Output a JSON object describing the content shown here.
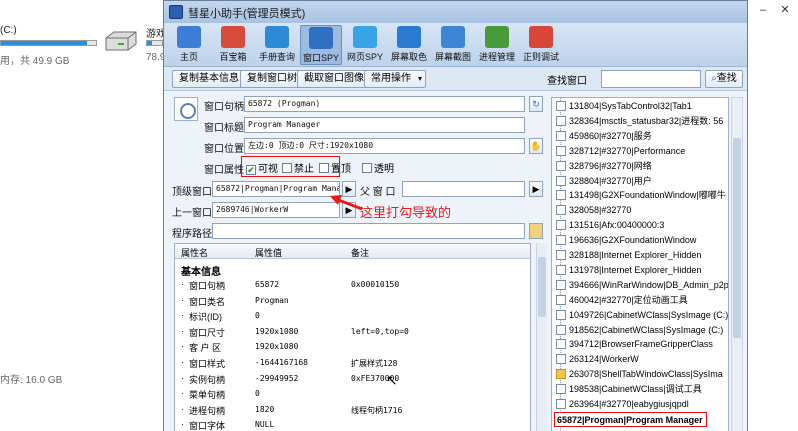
{
  "background": {
    "drive_c": {
      "label": "(C:)",
      "free_text": "用，共 49.9 GB",
      "fill_fraction": 0.9
    },
    "drive_game": {
      "label": "游戏",
      "size_text": "78.9",
      "fill_fraction": 0.3
    },
    "memory_text": "内存: 16.0 GB"
  },
  "app": {
    "title": "彗星小助手(管理员模式)",
    "toolbar": [
      {
        "label": "主页",
        "icon": "home-icon",
        "color": "#3d7dd8"
      },
      {
        "label": "百宝箱",
        "icon": "toolbox-icon",
        "color": "#d84a3a"
      },
      {
        "label": "手册查询",
        "icon": "help-icon",
        "color": "#2c8bd6"
      },
      {
        "label": "窗口SPY",
        "icon": "window-spy-icon",
        "color": "#2f6fc0",
        "active": true
      },
      {
        "label": "网页SPY",
        "icon": "web-spy-icon",
        "color": "#3aa2e6"
      },
      {
        "label": "屏幕取色",
        "icon": "color-picker-icon",
        "color": "#2a7bd0"
      },
      {
        "label": "屏幕截图",
        "icon": "screenshot-icon",
        "color": "#3c86d8"
      },
      {
        "label": "进程管理",
        "icon": "process-icon",
        "color": "#4a9a3a"
      },
      {
        "label": "正则调试",
        "icon": "regex-icon",
        "color": "#d8463a"
      }
    ],
    "commands": {
      "copy_info": "复制基本信息",
      "copy_tree": "复制窗口树",
      "capture": "截取窗口图像",
      "common_ops": "常用操作",
      "search_label": "查找窗口",
      "search_button": "查找"
    },
    "form": {
      "handle_label": "窗口句柄",
      "handle_value": "65872 (Progman)",
      "title_label": "窗口标题",
      "title_value": "Program Manager",
      "pos_label": "窗口位置",
      "pos_value": "左边:0 顶边:0 尺寸:1920x1080",
      "attr_label": "窗口属性",
      "attrs": [
        {
          "label": "可视",
          "checked": true
        },
        {
          "label": "禁止",
          "checked": false
        },
        {
          "label": "置顶",
          "checked": false
        },
        {
          "label": "透明",
          "checked": false
        }
      ],
      "top_label": "顶级窗口",
      "top_value": "65872|Progman|Program Manag",
      "parent_label": "父 窗 口",
      "parent_value": "",
      "prev_label": "上一窗口",
      "prev_value": "2689746|WorkerW",
      "path_label": "程序路径",
      "path_value": ""
    },
    "annotation": "这里打勾导致的",
    "grid": {
      "columns": [
        "属性名",
        "属性值",
        "备注"
      ],
      "section": "基本信息",
      "rows": [
        {
          "name": "窗口句柄",
          "value": "65872",
          "note": "0x00010150"
        },
        {
          "name": "窗口类名",
          "value": "Progman",
          "note": ""
        },
        {
          "name": "标识(ID)",
          "value": "0",
          "note": ""
        },
        {
          "name": "窗口尺寸",
          "value": "1920x1080",
          "note": "left=0,top=0"
        },
        {
          "name": "客 户 区",
          "value": "1920x1080",
          "note": ""
        },
        {
          "name": "窗口样式",
          "value": "-1644167168",
          "note": "扩展样式128"
        },
        {
          "name": "实例句柄",
          "value": "-29949952",
          "note": "0xFE370000"
        },
        {
          "name": "菜单句柄",
          "value": "0",
          "note": ""
        },
        {
          "name": "进程句柄",
          "value": "1820",
          "note": "线程句柄1716"
        },
        {
          "name": "窗口字体",
          "value": "NULL",
          "note": ""
        }
      ]
    },
    "tree": [
      {
        "text": "131804|SysTabControl32|Tab1",
        "folder": false
      },
      {
        "text": "328364|msctls_statusbar32|进程数: 56",
        "folder": false
      },
      {
        "text": "459860|#32770|服务",
        "folder": false
      },
      {
        "text": "328712|#32770|Performance",
        "folder": false
      },
      {
        "text": "328796|#32770|网络",
        "folder": false
      },
      {
        "text": "328804|#32770|用户",
        "folder": false
      },
      {
        "text": "131498|G2XFoundationWindow|嘟嘟牛",
        "folder": false
      },
      {
        "text": "328058|#32770",
        "folder": false
      },
      {
        "text": "131516|Afx:00400000:3",
        "folder": false
      },
      {
        "text": "196636|G2XFoundationWindow",
        "folder": false
      },
      {
        "text": "328188|Internet Explorer_Hidden",
        "folder": false
      },
      {
        "text": "131978|Internet Explorer_Hidden",
        "folder": false
      },
      {
        "text": "394666|WinRarWindow|DB_Admin_p2p.z",
        "folder": false
      },
      {
        "text": "460042|#32770|定位动画工具",
        "folder": false
      },
      {
        "text": "1049726|CabinetWClass|SysImage (C:)",
        "folder": false
      },
      {
        "text": "918562|CabinetWClass|SysImage (C:)",
        "folder": false
      },
      {
        "text": "394712|BrowserFrameGripperClass",
        "folder": false
      },
      {
        "text": "263124|WorkerW",
        "folder": false
      },
      {
        "text": "263078|ShellTabWindowClass|SysIma",
        "folder": true
      },
      {
        "text": "198538|CabinetWClass|调试工具",
        "folder": false
      },
      {
        "text": "263964|#32770|eabygiusjqpdl",
        "folder": false
      },
      {
        "text": "65872|Progman|Program Manager",
        "folder": false,
        "selected": true
      }
    ]
  }
}
